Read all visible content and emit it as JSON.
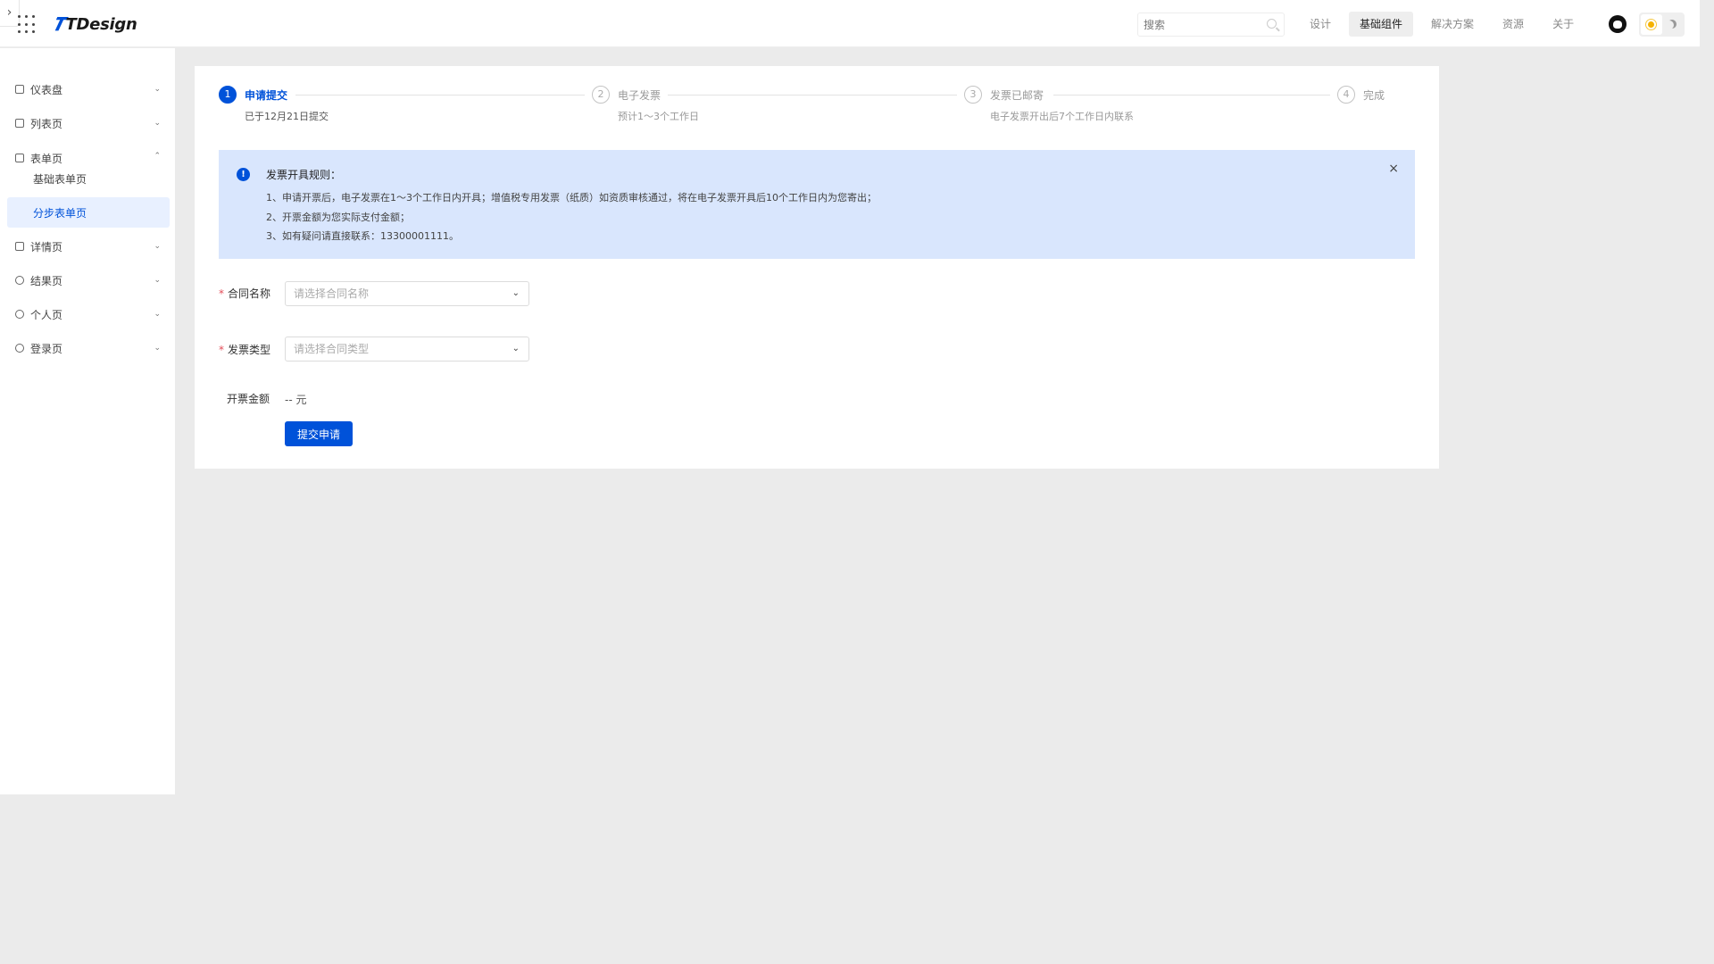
{
  "header": {
    "expand_glyph": "›",
    "logo_text": "TDesign",
    "search_placeholder": "搜索",
    "nav": [
      "设计",
      "基础组件",
      "解决方案",
      "资源",
      "关于"
    ],
    "active_nav": "基础组件"
  },
  "sidebar": {
    "items": [
      {
        "label": "仪表盘",
        "icon": "dashboard-icon",
        "expanded": false
      },
      {
        "label": "列表页",
        "icon": "list-icon",
        "expanded": false
      },
      {
        "label": "表单页",
        "icon": "edit-icon",
        "expanded": true
      },
      {
        "label": "详情页",
        "icon": "detail-icon",
        "expanded": false
      },
      {
        "label": "结果页",
        "icon": "check-circle-icon",
        "expanded": false
      },
      {
        "label": "个人页",
        "icon": "user-circle-icon",
        "expanded": false
      },
      {
        "label": "登录页",
        "icon": "login-icon",
        "expanded": false
      }
    ],
    "sub_items": [
      {
        "label": "基础表单页",
        "active": false
      },
      {
        "label": "分步表单页",
        "active": true
      }
    ]
  },
  "steps": [
    {
      "num": "1",
      "title": "申请提交",
      "desc": "已于12月21日提交",
      "active": true
    },
    {
      "num": "2",
      "title": "电子发票",
      "desc": "预计1～3个工作日",
      "active": false
    },
    {
      "num": "3",
      "title": "发票已邮寄",
      "desc": "电子发票开出后7个工作日内联系",
      "active": false
    },
    {
      "num": "4",
      "title": "完成",
      "desc": "",
      "active": false
    }
  ],
  "alert": {
    "icon": "!",
    "title": "发票开具规则：",
    "lines": [
      "1、申请开票后，电子发票在1～3个工作日内开具；增值税专用发票（纸质）如资质审核通过，将在电子发票开具后10个工作日内为您寄出；",
      "2、开票金额为您实际支付金额；",
      "3、如有疑问请直接联系：13300001111。"
    ],
    "close": "×"
  },
  "form": {
    "contract_label": "合同名称",
    "contract_placeholder": "请选择合同名称",
    "invoice_type_label": "发票类型",
    "invoice_type_placeholder": "请选择合同类型",
    "amount_label": "开票金额",
    "amount_value": "-- 元",
    "required_mark": "*",
    "submit_label": "提交申请"
  },
  "colors": {
    "brand": "#0052d9",
    "alert_bg": "#d9e6fd",
    "required": "#e34d59"
  }
}
